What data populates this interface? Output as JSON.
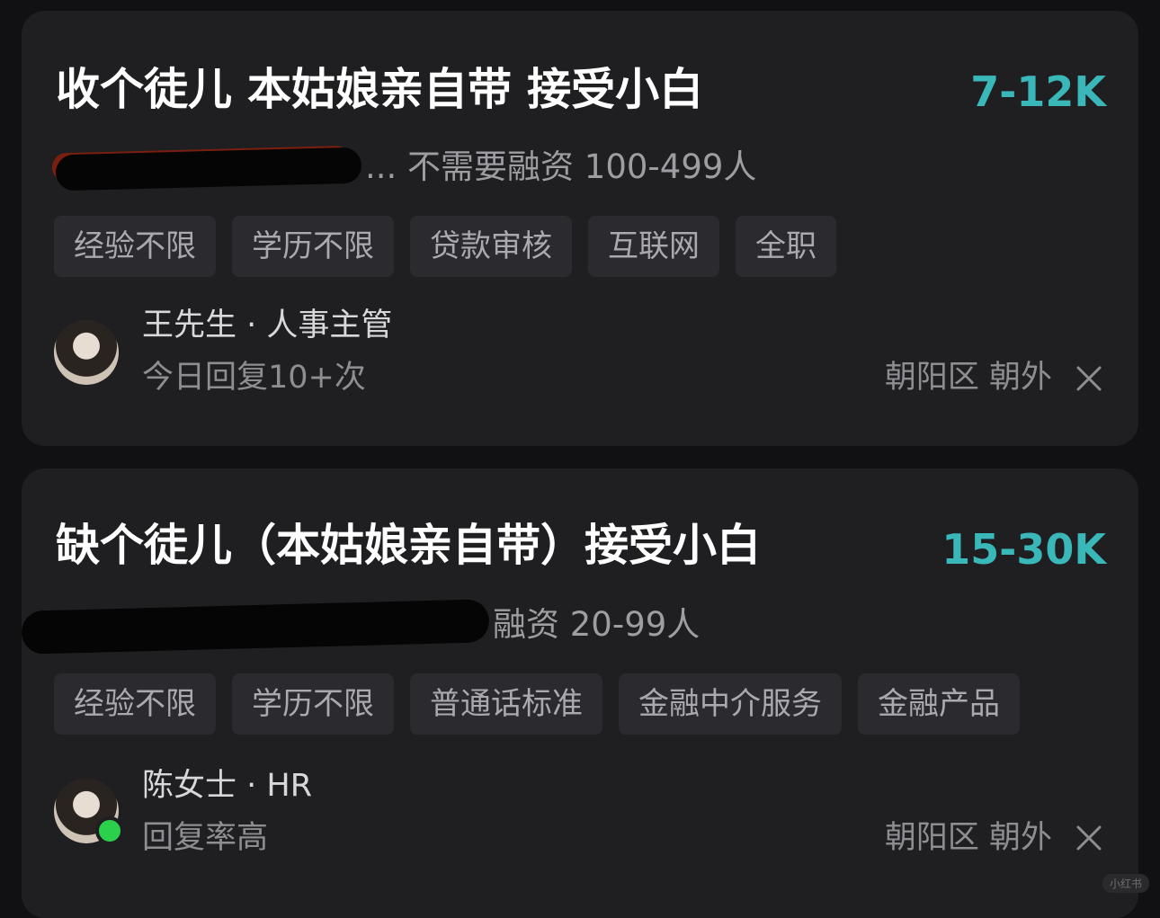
{
  "jobs": [
    {
      "title": "收个徒儿 本姑娘亲自带 接受小白",
      "salary": "7-12K",
      "company_visible": "... 不需要融资 100-499人",
      "tags": [
        "经验不限",
        "学历不限",
        "贷款审核",
        "互联网",
        "全职"
      ],
      "recruiter": "王先生 · 人事主管",
      "reply_status": "今日回复10+次",
      "location": "朝阳区 朝外",
      "avatar_icon": "recruiter-avatar",
      "online": false
    },
    {
      "title": "缺个徒儿（本姑娘亲自带）接受小白",
      "salary": "15-30K",
      "company_visible": "融资 20-99人",
      "tags": [
        "经验不限",
        "学历不限",
        "普通话标准",
        "金融中介服务",
        "金融产品"
      ],
      "recruiter": "陈女士 · HR",
      "reply_status": "回复率高",
      "location": "朝阳区 朝外",
      "avatar_icon": "recruiter-avatar",
      "online": true
    }
  ],
  "watermark": "小红书",
  "colors": {
    "background": "#111113",
    "card": "#1f1f22",
    "salary": "#3ab7b8",
    "tag_bg": "#2b2b2f",
    "online": "#2bd14b"
  }
}
